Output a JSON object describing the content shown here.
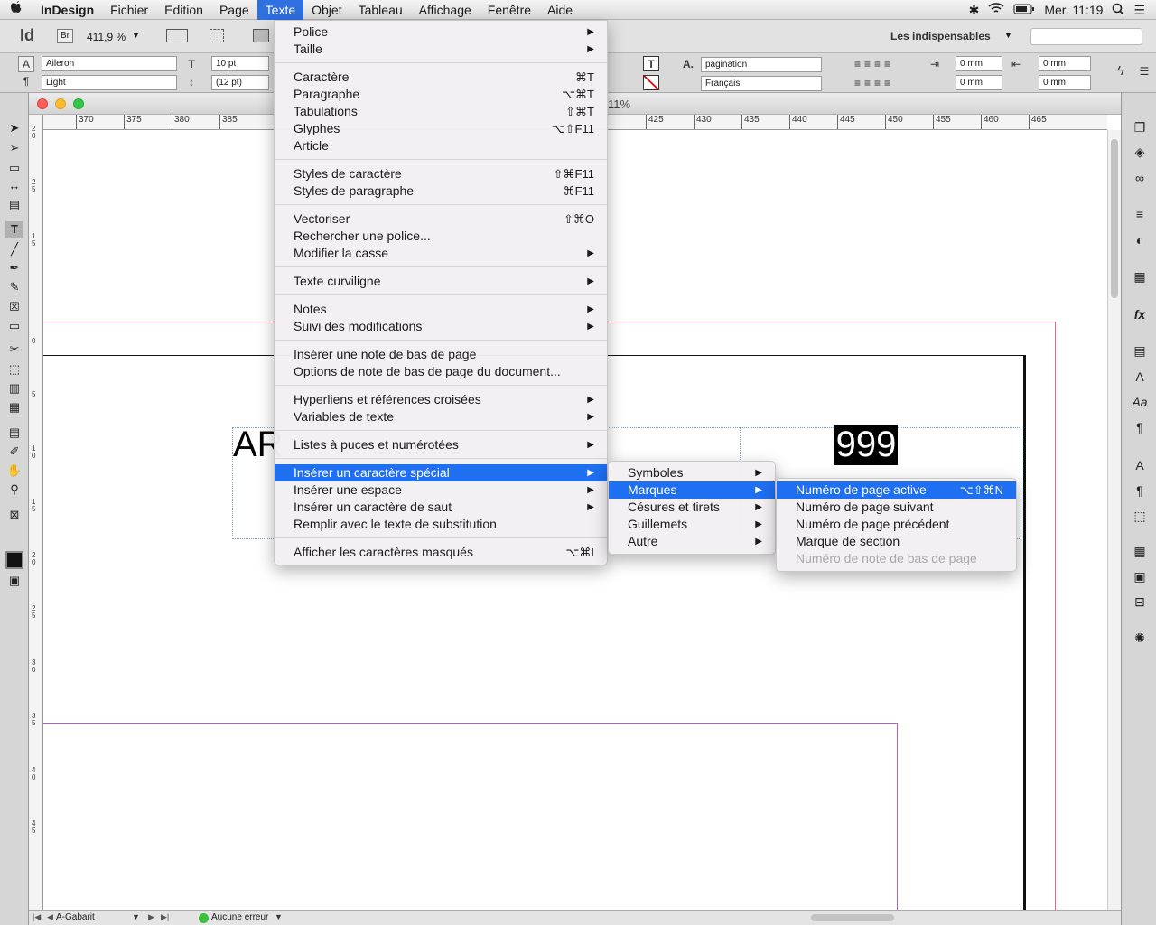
{
  "menubar": {
    "apple": "",
    "app": "InDesign",
    "items": [
      "Fichier",
      "Edition",
      "Page",
      "Texte",
      "Objet",
      "Tableau",
      "Affichage",
      "Fenêtre",
      "Aide"
    ],
    "clock": "Mer. 11:19"
  },
  "topbar": {
    "logo": "Id",
    "bridge": "Br",
    "zoom": "411,9 %",
    "workspace": "Les indispensables"
  },
  "control": {
    "font_family": "Aileron",
    "font_style": "Light",
    "font_size": "10 pt",
    "leading": "(12 pt)",
    "char_style": "pagination",
    "language": "Français",
    "indent_left": "0 mm",
    "indent_first": "0 mm",
    "space_before": "0 mm",
    "space_after": "0 mm"
  },
  "document": {
    "tab_zoom": "11%",
    "ruler_labels": [
      "370",
      "375",
      "380",
      "385",
      "425",
      "430",
      "435",
      "440",
      "445",
      "450",
      "455",
      "460",
      "465"
    ],
    "vruler_labels": [
      "2\n0",
      "2\n5",
      "1\n5",
      "0",
      "5",
      "1\n0",
      "1\n5",
      "2\n0",
      "2\n5",
      "3\n0",
      "3\n5",
      "4\n0",
      "4\n5"
    ],
    "text_left": "AR",
    "page_number": "999"
  },
  "status": {
    "master": "A-Gabarit",
    "preflight": "Aucune erreur"
  },
  "menu_texte": {
    "groups": [
      [
        {
          "label": "Police",
          "sub": true
        },
        {
          "label": "Taille",
          "sub": true
        }
      ],
      [
        {
          "label": "Caractère",
          "sc": "⌘T"
        },
        {
          "label": "Paragraphe",
          "sc": "⌥⌘T"
        },
        {
          "label": "Tabulations",
          "sc": "⇧⌘T"
        },
        {
          "label": "Glyphes",
          "sc": "⌥⇧F11"
        },
        {
          "label": "Article",
          "sc": ""
        }
      ],
      [
        {
          "label": "Styles de caractère",
          "sc": "⇧⌘F11"
        },
        {
          "label": "Styles de paragraphe",
          "sc": "⌘F11"
        }
      ],
      [
        {
          "label": "Vectoriser",
          "sc": "⇧⌘O"
        },
        {
          "label": "Rechercher une police...",
          "sc": ""
        },
        {
          "label": "Modifier la casse",
          "sub": true
        }
      ],
      [
        {
          "label": "Texte curviligne",
          "sub": true
        }
      ],
      [
        {
          "label": "Notes",
          "sub": true
        },
        {
          "label": "Suivi des modifications",
          "sub": true
        }
      ],
      [
        {
          "label": "Insérer une note de bas de page",
          "sc": ""
        },
        {
          "label": "Options de note de bas de page du document...",
          "sc": ""
        }
      ],
      [
        {
          "label": "Hyperliens et références croisées",
          "sub": true
        },
        {
          "label": "Variables de texte",
          "sub": true
        }
      ],
      [
        {
          "label": "Listes à puces et numérotées",
          "sub": true
        }
      ],
      [
        {
          "label": "Insérer un caractère spécial",
          "sub": true,
          "hl": true
        },
        {
          "label": "Insérer une espace",
          "sub": true
        },
        {
          "label": "Insérer un caractère de saut",
          "sub": true
        },
        {
          "label": "Remplir avec le texte de substitution",
          "sc": ""
        }
      ],
      [
        {
          "label": "Afficher les caractères masqués",
          "sc": "⌥⌘I"
        }
      ]
    ]
  },
  "menu_special": {
    "items": [
      {
        "label": "Symboles",
        "sub": true
      },
      {
        "label": "Marques",
        "sub": true,
        "hl": true
      },
      {
        "label": "Césures et tirets",
        "sub": true
      },
      {
        "label": "Guillemets",
        "sub": true
      },
      {
        "label": "Autre",
        "sub": true
      }
    ]
  },
  "menu_marques": {
    "items": [
      {
        "label": "Numéro de page active",
        "sc": "⌥⇧⌘N",
        "hl": true
      },
      {
        "label": "Numéro de page suivant",
        "sc": ""
      },
      {
        "label": "Numéro de page précédent",
        "sc": ""
      },
      {
        "label": "Marque de section",
        "sc": ""
      },
      {
        "label": "Numéro de note de bas de page",
        "sc": "",
        "dis": true
      }
    ]
  }
}
